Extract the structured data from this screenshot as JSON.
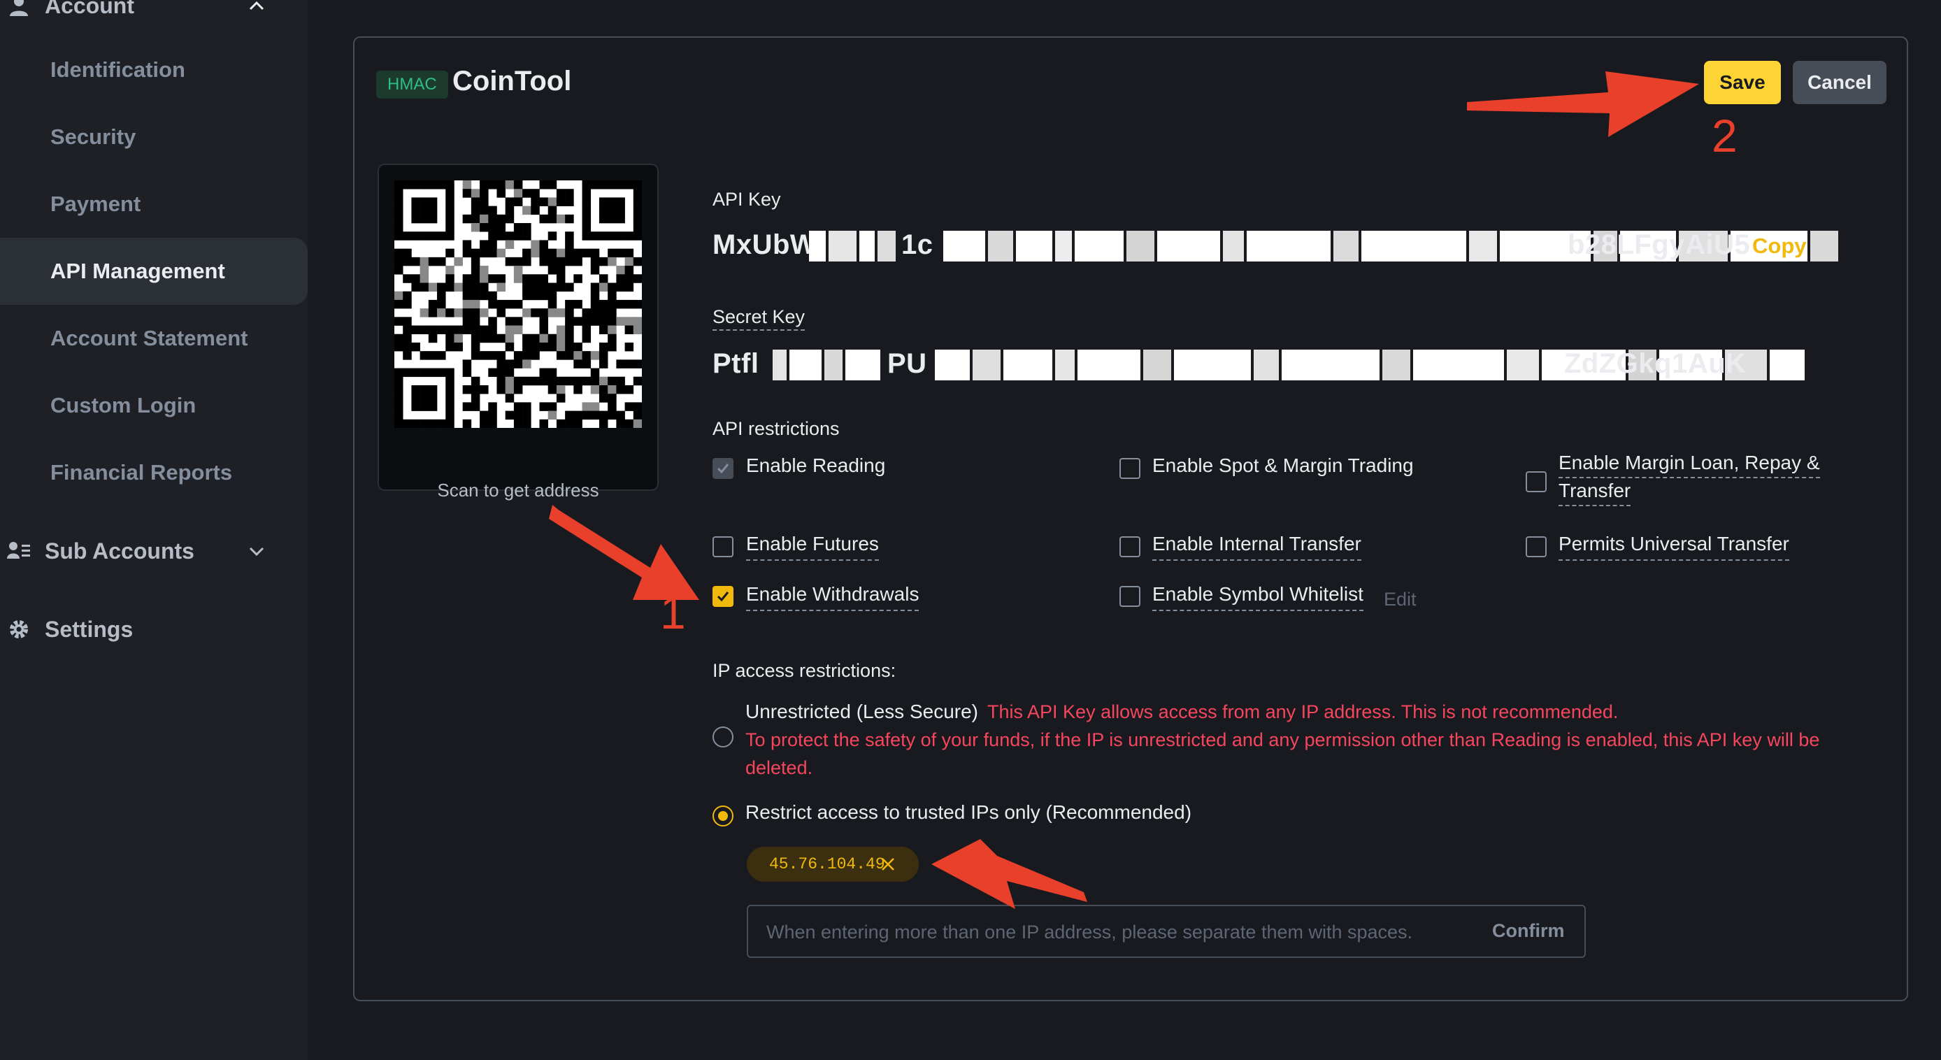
{
  "sidebar": {
    "account": {
      "label": "Account"
    },
    "items": [
      {
        "label": "Identification"
      },
      {
        "label": "Security"
      },
      {
        "label": "Payment"
      },
      {
        "label": "API Management",
        "active": true
      },
      {
        "label": "Account Statement"
      },
      {
        "label": "Custom Login"
      },
      {
        "label": "Financial Reports"
      }
    ],
    "sub_accounts": {
      "label": "Sub Accounts"
    },
    "settings": {
      "label": "Settings"
    }
  },
  "card": {
    "badge": "HMAC",
    "title": "CoinTool",
    "save_label": "Save",
    "cancel_label": "Cancel",
    "qr_caption": "Scan to get address",
    "api_key_label": "API Key",
    "api_key_start": "MxUbW",
    "api_key_mid": "1c",
    "api_key_end": "b28LFgyAiU5",
    "copy_label": "Copy",
    "secret_key_label": "Secret Key",
    "secret_key_start": "Ptfl",
    "secret_key_mid": "PU",
    "secret_key_end": "ZdZGkq1AuK",
    "restrictions_label": "API restrictions",
    "restrictions": {
      "reading": {
        "label": "Enable Reading",
        "checked": true
      },
      "spot_margin": {
        "label": "Enable Spot & Margin Trading",
        "checked": false
      },
      "margin_loan_line1": "Enable Margin Loan, Repay &",
      "margin_loan_line2": "Transfer",
      "futures": {
        "label": "Enable Futures",
        "checked": false
      },
      "internal_transfer": {
        "label": "Enable Internal Transfer",
        "checked": false
      },
      "universal_transfer": {
        "label": "Permits Universal Transfer",
        "checked": false
      },
      "withdrawals": {
        "label": "Enable Withdrawals",
        "checked": true
      },
      "symbol_whitelist": {
        "label": "Enable Symbol Whitelist",
        "checked": false
      },
      "edit_label": "Edit"
    },
    "ip_label": "IP access restrictions:",
    "unrestricted": {
      "label": "Unrestricted (Less Secure)",
      "warning1": "This API Key allows access from any IP address. This is not recommended.",
      "warning2": "To protect the safety of your funds, if the IP is unrestricted and any permission other than Reading is enabled, this API key will be",
      "warning3": "deleted."
    },
    "restricted": {
      "label": "Restrict access to trusted IPs only (Recommended)",
      "selected": true
    },
    "ip_tags": [
      "45.76.104.49"
    ],
    "ip_input_placeholder": "When entering more than one IP address, please separate them with spaces.",
    "ip_confirm_label": "Confirm"
  },
  "annotations": {
    "step1": "1",
    "step2": "2",
    "arrow_color": "#e8402b"
  },
  "colors": {
    "accent": "#f0b90b",
    "save": "#fcd535",
    "danger": "#f6465d",
    "positive": "#2ebd85"
  }
}
